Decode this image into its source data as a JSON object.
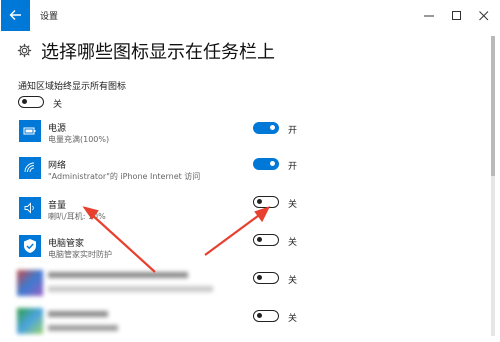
{
  "window": {
    "title": "设置"
  },
  "page": {
    "title": "选择哪些图标显示在任务栏上"
  },
  "always_show": {
    "label": "通知区域始终显示所有图标",
    "state": "关",
    "on": false
  },
  "apps": [
    {
      "name": "电源",
      "desc": "电量充满(100%)",
      "icon": "battery-icon",
      "state": "开",
      "on": true
    },
    {
      "name": "网络",
      "desc": "\"Administrator\"的 iPhone Internet 访问",
      "icon": "wifi-icon",
      "state": "开",
      "on": true
    },
    {
      "name": "音量",
      "desc": "喇叭/耳机: 10%",
      "icon": "speaker-icon",
      "state": "关",
      "on": false
    },
    {
      "name": "电脑管家",
      "desc": "电脑管家实时防护",
      "icon": "shield-icon",
      "state": "关",
      "on": false
    },
    {
      "name": "",
      "desc": "",
      "icon": "app-icon",
      "state": "关",
      "on": false
    },
    {
      "name": "",
      "desc": "",
      "icon": "app-icon",
      "state": "关",
      "on": false
    }
  ],
  "colors": {
    "accent": "#0078d7",
    "arrow": "#e8402f"
  }
}
